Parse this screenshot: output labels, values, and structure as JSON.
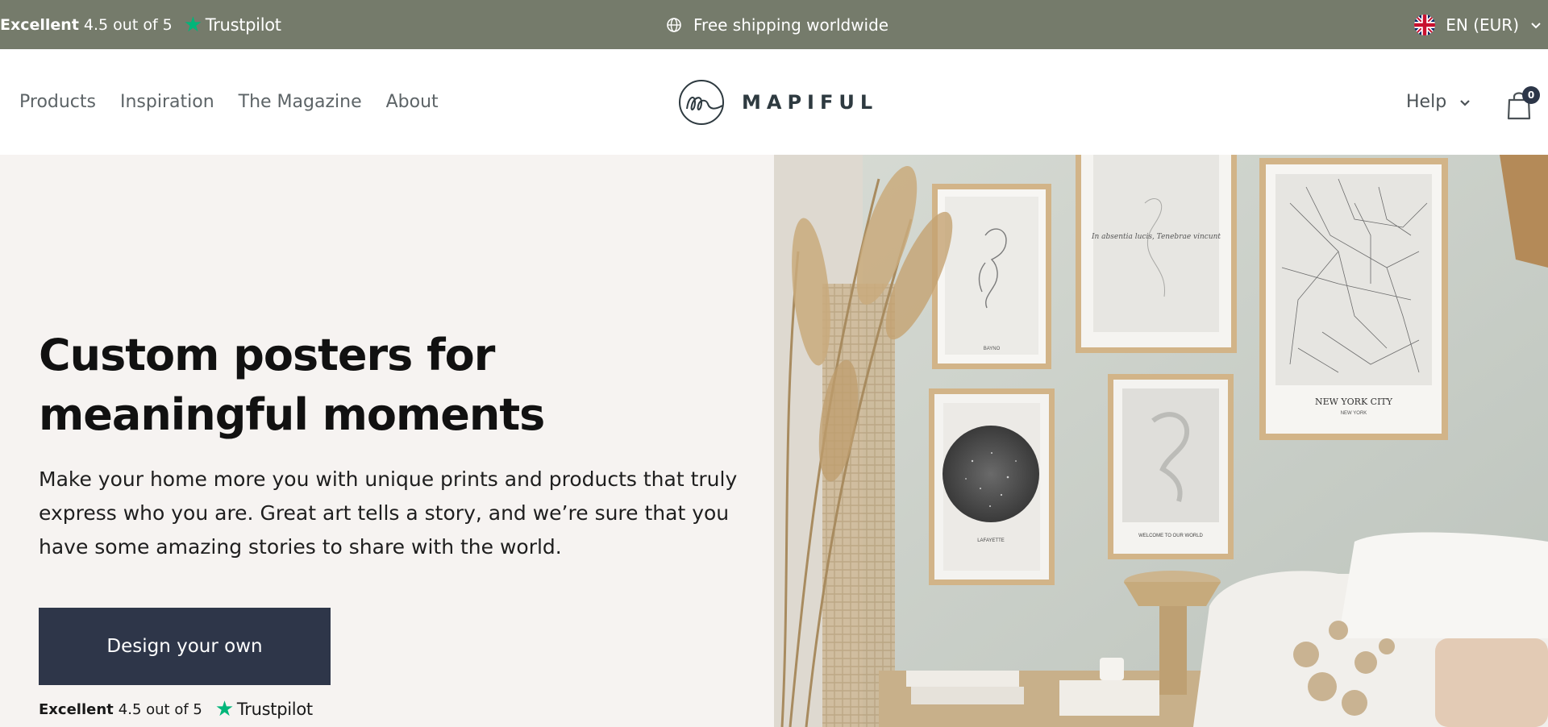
{
  "announcement": {
    "rating_label": "Excellent",
    "rating_value": "4.5 out of 5",
    "trustpilot": "Trustpilot",
    "shipping": "Free shipping worldwide",
    "locale": "EN (EUR)"
  },
  "header": {
    "nav": [
      "Products",
      "Inspiration",
      "The Magazine",
      "About"
    ],
    "logo": "MAPIFUL",
    "help": "Help",
    "cart_count": "0"
  },
  "hero": {
    "title_line1": "Custom posters for",
    "title_line2": "meaningful moments",
    "body": "Make your home more you with unique prints and products that truly express who you are. Great art tells a story, and we’re sure that you have some amazing stories to share with the world.",
    "cta": "Design your own",
    "rating_label": "Excellent",
    "rating_value": "4.5 out of 5",
    "trustpilot": "Trustpilot"
  },
  "image": {
    "poster_left_text_1": "BAYNO",
    "poster_middle_text": "In absentia lucis, Tenebrae vincunt",
    "poster_right_title": "NEW YORK CITY",
    "poster_right_sub": "NEW YORK",
    "poster_star_title": "LAFAYETTE",
    "poster_baby_title": "WELCOME TO OUR WORLD"
  },
  "colors": {
    "announcement_bg": "#757b6b",
    "cta_bg": "#2e3649",
    "hero_bg": "#f6f3f1",
    "trustpilot_green": "#00b67a"
  }
}
